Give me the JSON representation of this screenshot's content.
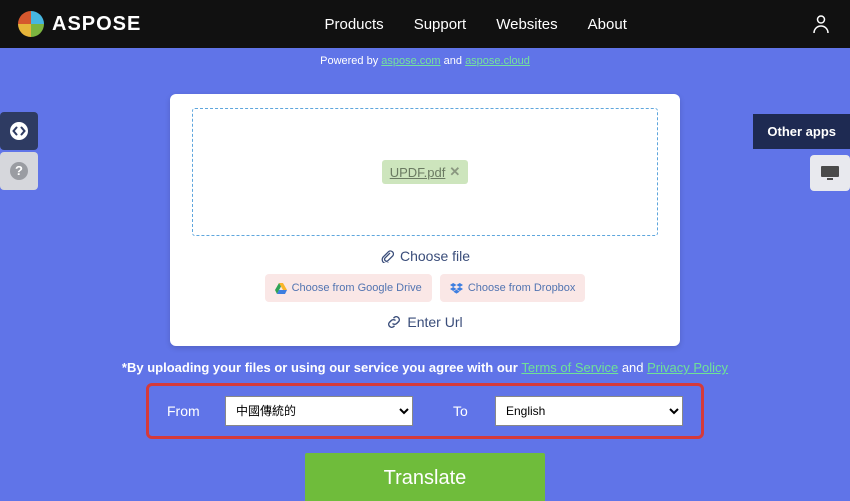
{
  "header": {
    "brand": "ASPOSE",
    "nav": {
      "products": "Products",
      "support": "Support",
      "websites": "Websites",
      "about": "About"
    }
  },
  "powered": {
    "prefix": "Powered by ",
    "link1": "aspose.com",
    "mid": " and ",
    "link2": "aspose.cloud"
  },
  "side": {
    "other_apps": "Other apps"
  },
  "upload": {
    "file_name": "UPDF.pdf",
    "choose_file": "Choose file",
    "from_drive": "Choose from Google Drive",
    "from_dropbox": "Choose from Dropbox",
    "enter_url": "Enter Url"
  },
  "agree": {
    "prefix": "*By uploading your files or using our service you agree with our ",
    "tos": "Terms of Service",
    "and": " and ",
    "pp": "Privacy Policy"
  },
  "lang": {
    "from_label": "From",
    "to_label": "To",
    "from_value": "中國傳統的",
    "to_value": "English"
  },
  "actions": {
    "translate": "Translate"
  }
}
